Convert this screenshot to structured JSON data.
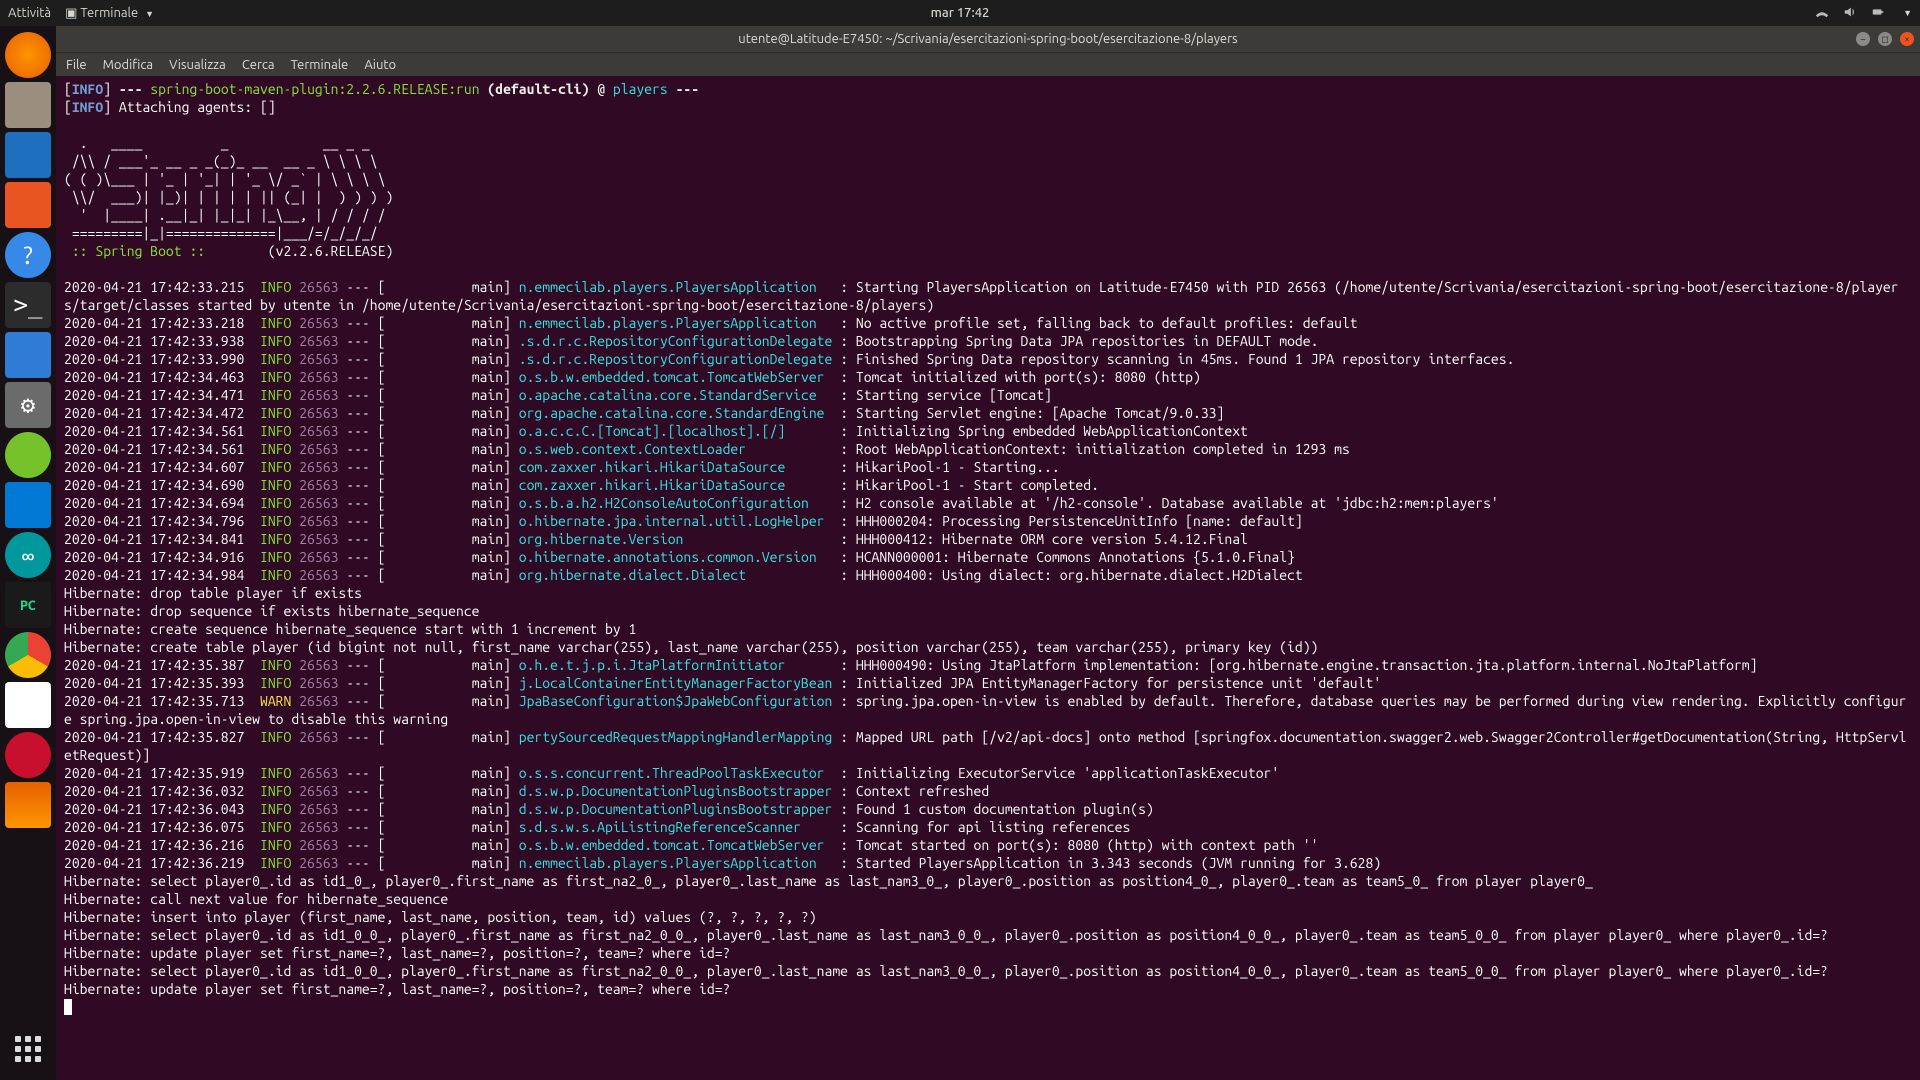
{
  "topbar": {
    "activities": "Attività",
    "app_menu": "Terminale",
    "clock": "mar 17:42"
  },
  "window": {
    "title": "utente@Latitude-E7450: ~/Scrivania/esercitazioni-spring-boot/esercitazione-8/players"
  },
  "menubar": {
    "file": "File",
    "edit": "Modifica",
    "view": "Visualizza",
    "search": "Cerca",
    "terminal": "Terminale",
    "help": "Aiuto"
  },
  "term": {
    "spring_version": "(v2.2.6.RELEASE)",
    "l1_info": "INFO",
    "l1_plugin": "spring-boot-maven-plugin:2.2.6.RELEASE:run",
    "l1_cli": "(default-cli)",
    "l1_at": "@",
    "l1_players": "players",
    "l2_attach": "Attaching agents: []",
    "banner1": "  .   ____          _            __ _ _",
    "banner2": " /\\\\ / ___'_ __ _ _(_)_ __  __ _ \\ \\ \\ \\",
    "banner3": "( ( )\\___ | '_ | '_| | '_ \\/ _` | \\ \\ \\ \\",
    "banner4": " \\\\/  ___)| |_)| | | | | || (_| |  ) ) ) )",
    "banner5": "  '  |____| .__|_| |_|_| |_\\__, | / / / /",
    "banner6": " =========|_|==============|___/=/_/_/_/",
    "banner7": " :: Spring Boot ::        ",
    "rows": [
      {
        "ts": "2020-04-21 17:42:33.215",
        "lvl": "INFO",
        "pid": "26563",
        "thr": "main",
        "logger": "n.emmecilab.players.PlayersApplication",
        "msg": "Starting PlayersApplication on Latitude-E7450 with PID 26563 (/home/utente/Scrivania/esercitazioni-spring-boot/esercitazione-8/players/target/classes started by utente in /home/utente/Scrivania/esercitazioni-spring-boot/esercitazione-8/players)"
      },
      {
        "ts": "2020-04-21 17:42:33.218",
        "lvl": "INFO",
        "pid": "26563",
        "thr": "main",
        "logger": "n.emmecilab.players.PlayersApplication",
        "msg": "No active profile set, falling back to default profiles: default"
      },
      {
        "ts": "2020-04-21 17:42:33.938",
        "lvl": "INFO",
        "pid": "26563",
        "thr": "main",
        "logger": ".s.d.r.c.RepositoryConfigurationDelegate",
        "msg": "Bootstrapping Spring Data JPA repositories in DEFAULT mode."
      },
      {
        "ts": "2020-04-21 17:42:33.990",
        "lvl": "INFO",
        "pid": "26563",
        "thr": "main",
        "logger": ".s.d.r.c.RepositoryConfigurationDelegate",
        "msg": "Finished Spring Data repository scanning in 45ms. Found 1 JPA repository interfaces."
      },
      {
        "ts": "2020-04-21 17:42:34.463",
        "lvl": "INFO",
        "pid": "26563",
        "thr": "main",
        "logger": "o.s.b.w.embedded.tomcat.TomcatWebServer",
        "msg": "Tomcat initialized with port(s): 8080 (http)"
      },
      {
        "ts": "2020-04-21 17:42:34.471",
        "lvl": "INFO",
        "pid": "26563",
        "thr": "main",
        "logger": "o.apache.catalina.core.StandardService",
        "msg": "Starting service [Tomcat]"
      },
      {
        "ts": "2020-04-21 17:42:34.472",
        "lvl": "INFO",
        "pid": "26563",
        "thr": "main",
        "logger": "org.apache.catalina.core.StandardEngine",
        "msg": "Starting Servlet engine: [Apache Tomcat/9.0.33]"
      },
      {
        "ts": "2020-04-21 17:42:34.561",
        "lvl": "INFO",
        "pid": "26563",
        "thr": "main",
        "logger": "o.a.c.c.C.[Tomcat].[localhost].[/]",
        "msg": "Initializing Spring embedded WebApplicationContext"
      },
      {
        "ts": "2020-04-21 17:42:34.561",
        "lvl": "INFO",
        "pid": "26563",
        "thr": "main",
        "logger": "o.s.web.context.ContextLoader",
        "msg": "Root WebApplicationContext: initialization completed in 1293 ms"
      },
      {
        "ts": "2020-04-21 17:42:34.607",
        "lvl": "INFO",
        "pid": "26563",
        "thr": "main",
        "logger": "com.zaxxer.hikari.HikariDataSource",
        "msg": "HikariPool-1 - Starting..."
      },
      {
        "ts": "2020-04-21 17:42:34.690",
        "lvl": "INFO",
        "pid": "26563",
        "thr": "main",
        "logger": "com.zaxxer.hikari.HikariDataSource",
        "msg": "HikariPool-1 - Start completed."
      },
      {
        "ts": "2020-04-21 17:42:34.694",
        "lvl": "INFO",
        "pid": "26563",
        "thr": "main",
        "logger": "o.s.b.a.h2.H2ConsoleAutoConfiguration",
        "msg": "H2 console available at '/h2-console'. Database available at 'jdbc:h2:mem:players'"
      },
      {
        "ts": "2020-04-21 17:42:34.796",
        "lvl": "INFO",
        "pid": "26563",
        "thr": "main",
        "logger": "o.hibernate.jpa.internal.util.LogHelper",
        "msg": "HHH000204: Processing PersistenceUnitInfo [name: default]"
      },
      {
        "ts": "2020-04-21 17:42:34.841",
        "lvl": "INFO",
        "pid": "26563",
        "thr": "main",
        "logger": "org.hibernate.Version",
        "msg": "HHH000412: Hibernate ORM core version 5.4.12.Final"
      },
      {
        "ts": "2020-04-21 17:42:34.916",
        "lvl": "INFO",
        "pid": "26563",
        "thr": "main",
        "logger": "o.hibernate.annotations.common.Version",
        "msg": "HCANN000001: Hibernate Commons Annotations {5.1.0.Final}"
      },
      {
        "ts": "2020-04-21 17:42:34.984",
        "lvl": "INFO",
        "pid": "26563",
        "thr": "main",
        "logger": "org.hibernate.dialect.Dialect",
        "msg": "HHH000400: Using dialect: org.hibernate.dialect.H2Dialect"
      }
    ],
    "hib1": "Hibernate: drop table player if exists",
    "hib2": "Hibernate: drop sequence if exists hibernate_sequence",
    "hib3": "Hibernate: create sequence hibernate_sequence start with 1 increment by 1",
    "hib4": "Hibernate: create table player (id bigint not null, first_name varchar(255), last_name varchar(255), position varchar(255), team varchar(255), primary key (id))",
    "rows2": [
      {
        "ts": "2020-04-21 17:42:35.387",
        "lvl": "INFO",
        "pid": "26563",
        "thr": "main",
        "logger": "o.h.e.t.j.p.i.JtaPlatformInitiator",
        "msg": "HHH000490: Using JtaPlatform implementation: [org.hibernate.engine.transaction.jta.platform.internal.NoJtaPlatform]"
      },
      {
        "ts": "2020-04-21 17:42:35.393",
        "lvl": "INFO",
        "pid": "26563",
        "thr": "main",
        "logger": "j.LocalContainerEntityManagerFactoryBean",
        "msg": "Initialized JPA EntityManagerFactory for persistence unit 'default'"
      },
      {
        "ts": "2020-04-21 17:42:35.713",
        "lvl": "WARN",
        "pid": "26563",
        "thr": "main",
        "logger": "JpaBaseConfiguration$JpaWebConfiguration",
        "msg": "spring.jpa.open-in-view is enabled by default. Therefore, database queries may be performed during view rendering. Explicitly configure spring.jpa.open-in-view to disable this warning"
      },
      {
        "ts": "2020-04-21 17:42:35.827",
        "lvl": "INFO",
        "pid": "26563",
        "thr": "main",
        "logger": "pertySourcedRequestMappingHandlerMapping",
        "msg": "Mapped URL path [/v2/api-docs] onto method [springfox.documentation.swagger2.web.Swagger2Controller#getDocumentation(String, HttpServletRequest)]"
      },
      {
        "ts": "2020-04-21 17:42:35.919",
        "lvl": "INFO",
        "pid": "26563",
        "thr": "main",
        "logger": "o.s.s.concurrent.ThreadPoolTaskExecutor",
        "msg": "Initializing ExecutorService 'applicationTaskExecutor'"
      },
      {
        "ts": "2020-04-21 17:42:36.032",
        "lvl": "INFO",
        "pid": "26563",
        "thr": "main",
        "logger": "d.s.w.p.DocumentationPluginsBootstrapper",
        "msg": "Context refreshed"
      },
      {
        "ts": "2020-04-21 17:42:36.043",
        "lvl": "INFO",
        "pid": "26563",
        "thr": "main",
        "logger": "d.s.w.p.DocumentationPluginsBootstrapper",
        "msg": "Found 1 custom documentation plugin(s)"
      },
      {
        "ts": "2020-04-21 17:42:36.075",
        "lvl": "INFO",
        "pid": "26563",
        "thr": "main",
        "logger": "s.d.s.w.s.ApiListingReferenceScanner",
        "msg": "Scanning for api listing references"
      },
      {
        "ts": "2020-04-21 17:42:36.216",
        "lvl": "INFO",
        "pid": "26563",
        "thr": "main",
        "logger": "o.s.b.w.embedded.tomcat.TomcatWebServer",
        "msg": "Tomcat started on port(s): 8080 (http) with context path ''"
      },
      {
        "ts": "2020-04-21 17:42:36.219",
        "lvl": "INFO",
        "pid": "26563",
        "thr": "main",
        "logger": "n.emmecilab.players.PlayersApplication",
        "msg": "Started PlayersApplication in 3.343 seconds (JVM running for 3.628)"
      }
    ],
    "hib5": "Hibernate: select player0_.id as id1_0_, player0_.first_name as first_na2_0_, player0_.last_name as last_nam3_0_, player0_.position as position4_0_, player0_.team as team5_0_ from player player0_",
    "hib6": "Hibernate: call next value for hibernate_sequence",
    "hib7": "Hibernate: insert into player (first_name, last_name, position, team, id) values (?, ?, ?, ?, ?)",
    "hib8": "Hibernate: select player0_.id as id1_0_0_, player0_.first_name as first_na2_0_0_, player0_.last_name as last_nam3_0_0_, player0_.position as position4_0_0_, player0_.team as team5_0_0_ from player player0_ where player0_.id=?",
    "hib9": "Hibernate: update player set first_name=?, last_name=?, position=?, team=? where id=?",
    "hib10": "Hibernate: select player0_.id as id1_0_0_, player0_.first_name as first_na2_0_0_, player0_.last_name as last_nam3_0_0_, player0_.position as position4_0_0_, player0_.team as team5_0_0_ from player player0_ where player0_.id=?",
    "hib11": "Hibernate: update player set first_name=?, last_name=?, position=?, team=? where id=?"
  }
}
